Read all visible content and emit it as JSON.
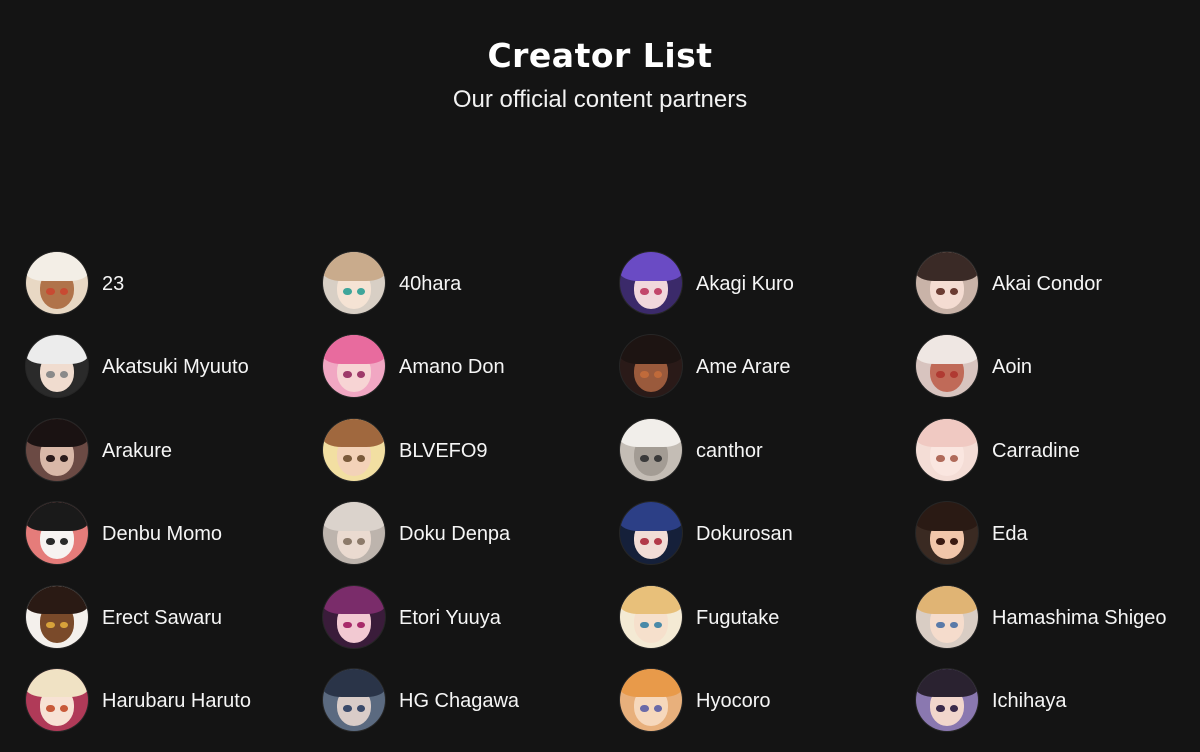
{
  "header": {
    "title": "Creator List",
    "subtitle": "Our official content partners"
  },
  "creators": [
    {
      "name": "23",
      "avatar": {
        "bg": "#e8d8c4",
        "hair": "#f3eee6",
        "skin": "#b0734a",
        "eye": "#c84a32"
      }
    },
    {
      "name": "40hara",
      "avatar": {
        "bg": "#d8cfc5",
        "hair": "#c9ab8c",
        "skin": "#f5e3d4",
        "eye": "#3fa59a"
      }
    },
    {
      "name": "Akagi Kuro",
      "avatar": {
        "bg": "#3b2a6a",
        "hair": "#6a4bc4",
        "skin": "#f1d7dc",
        "eye": "#c2466b"
      }
    },
    {
      "name": "Akai Condor",
      "avatar": {
        "bg": "#c9b3a8",
        "hair": "#3a2a26",
        "skin": "#f4dcd2",
        "eye": "#6b3c32"
      }
    },
    {
      "name": "Akatsuki Myuuto",
      "avatar": {
        "bg": "#2a2a2a",
        "hair": "#ececec",
        "skin": "#f0dccf",
        "eye": "#8a8a8a"
      }
    },
    {
      "name": "Amano Don",
      "avatar": {
        "bg": "#f1a7c3",
        "hair": "#e86b9e",
        "skin": "#f7d4d4",
        "eye": "#9e3a6a"
      }
    },
    {
      "name": "Ame Arare",
      "avatar": {
        "bg": "#2a1a18",
        "hair": "#1d1412",
        "skin": "#9a5a3c",
        "eye": "#c06a3a"
      }
    },
    {
      "name": "Aoin",
      "avatar": {
        "bg": "#d8c4bf",
        "hair": "#efe7e3",
        "skin": "#c06a58",
        "eye": "#b03a32"
      }
    },
    {
      "name": "Arakure",
      "avatar": {
        "bg": "#6b4a44",
        "hair": "#1a1212",
        "skin": "#d9b8a8",
        "eye": "#2a1a1a"
      }
    },
    {
      "name": "BLVEFO9",
      "avatar": {
        "bg": "#f2dfa2",
        "hair": "#a0683e",
        "skin": "#f3d2b8",
        "eye": "#7a5a3a"
      }
    },
    {
      "name": "canthor",
      "avatar": {
        "bg": "#c4bdb5",
        "hair": "#f1eeea",
        "skin": "#a39c94",
        "eye": "#3a3a3a"
      }
    },
    {
      "name": "Carradine",
      "avatar": {
        "bg": "#f4ddd6",
        "hair": "#f0c9c2",
        "skin": "#fae6e0",
        "eye": "#b06a5a"
      }
    },
    {
      "name": "Denbu Momo",
      "avatar": {
        "bg": "#e57c7a",
        "hair": "#1a1a1a",
        "skin": "#f7f3f1",
        "eye": "#2a2a2a"
      }
    },
    {
      "name": "Doku Denpa",
      "avatar": {
        "bg": "#bdb4ad",
        "hair": "#dbd3cc",
        "skin": "#eadad0",
        "eye": "#8c7a6a"
      }
    },
    {
      "name": "Dokurosan",
      "avatar": {
        "bg": "#15203a",
        "hair": "#2c3f86",
        "skin": "#f1dcd6",
        "eye": "#b23a4a"
      }
    },
    {
      "name": "Eda",
      "avatar": {
        "bg": "#3a2a22",
        "hair": "#2a1a14",
        "skin": "#f1c6aa",
        "eye": "#3a1a12"
      }
    },
    {
      "name": "Erect Sawaru",
      "avatar": {
        "bg": "#f4f0ec",
        "hair": "#2a1a14",
        "skin": "#7a4a2a",
        "eye": "#d8a23a"
      }
    },
    {
      "name": "Etori Yuuya",
      "avatar": {
        "bg": "#3a1c3a",
        "hair": "#7a2c6a",
        "skin": "#f2c9d2",
        "eye": "#a82a6a"
      }
    },
    {
      "name": "Fugutake",
      "avatar": {
        "bg": "#f4ead4",
        "hair": "#e8c07a",
        "skin": "#f6e0cc",
        "eye": "#4a8aa8"
      }
    },
    {
      "name": "Hamashima Shigeo",
      "avatar": {
        "bg": "#d9cdc4",
        "hair": "#e0b474",
        "skin": "#f5dccc",
        "eye": "#5a7aa8"
      }
    },
    {
      "name": "Harubaru Haruto",
      "avatar": {
        "bg": "#b03a58",
        "hair": "#f0e2c4",
        "skin": "#f7e2d4",
        "eye": "#c85a3a"
      }
    },
    {
      "name": "HG Chagawa",
      "avatar": {
        "bg": "#5b6a80",
        "hair": "#2a3448",
        "skin": "#d9ccc8",
        "eye": "#3a4a6a"
      }
    },
    {
      "name": "Hyocoro",
      "avatar": {
        "bg": "#e8b07c",
        "hair": "#e89a4a",
        "skin": "#f6d8bc",
        "eye": "#6a6aa8"
      }
    },
    {
      "name": "Ichihaya",
      "avatar": {
        "bg": "#8a78b0",
        "hair": "#2a2230",
        "skin": "#f1d6cc",
        "eye": "#3a2a4a"
      }
    }
  ]
}
